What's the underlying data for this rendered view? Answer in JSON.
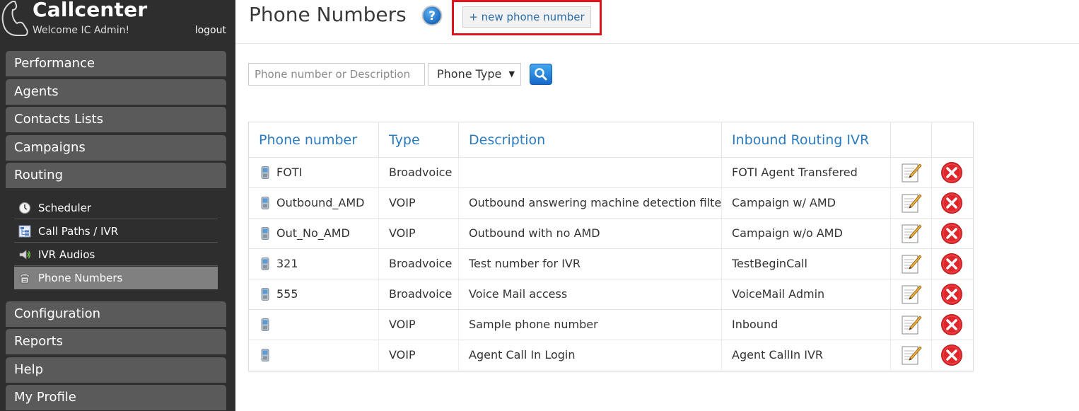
{
  "sidebar": {
    "brand_title": "Callcenter",
    "welcome": "Welcome IC Admin!",
    "logout": "logout",
    "nav_top": [
      {
        "label": "Performance"
      },
      {
        "label": "Agents"
      },
      {
        "label": "Contacts Lists"
      },
      {
        "label": "Campaigns"
      },
      {
        "label": "Routing"
      }
    ],
    "routing_submenu": [
      {
        "label": "Scheduler",
        "icon": "clock-icon"
      },
      {
        "label": "Call Paths / IVR",
        "icon": "call-path-icon"
      },
      {
        "label": "IVR Audios",
        "icon": "speaker-icon"
      },
      {
        "label": "Phone Numbers",
        "icon": "telephone-icon"
      }
    ],
    "nav_bottom": [
      {
        "label": "Configuration"
      },
      {
        "label": "Reports"
      },
      {
        "label": "Help"
      },
      {
        "label": "My Profile"
      }
    ]
  },
  "header": {
    "title": "Phone Numbers",
    "new_button": "+ new phone number"
  },
  "filters": {
    "search_placeholder": "Phone number or Description",
    "type_select": "Phone Type"
  },
  "table": {
    "headers": [
      "Phone number",
      "Type",
      "Description",
      "Inbound Routing IVR"
    ],
    "rows": [
      {
        "number": "FOTI",
        "type": "Broadvoice",
        "description": "",
        "ivr": "FOTI Agent Transfered"
      },
      {
        "number": "Outbound_AMD",
        "type": "VOIP",
        "description": "Outbound answering machine detection filter",
        "ivr": "Campaign w/ AMD"
      },
      {
        "number": "Out_No_AMD",
        "type": "VOIP",
        "description": "Outbound with no AMD",
        "ivr": "Campaign w/o AMD"
      },
      {
        "number": "321",
        "type": "Broadvoice",
        "description": "Test number for IVR",
        "ivr": "TestBeginCall"
      },
      {
        "number": "555",
        "type": "Broadvoice",
        "description": "Voice Mail access",
        "ivr": "VoiceMail Admin"
      },
      {
        "number": "",
        "type": "VOIP",
        "description": "Sample phone number",
        "ivr": "Inbound"
      },
      {
        "number": "",
        "type": "VOIP",
        "description": "Agent Call In Login",
        "ivr": "Agent CallIn IVR"
      }
    ]
  },
  "colors": {
    "sidebar_bg": "#2e2e2e",
    "nav_button": "#5a5a5a",
    "active_subitem": "#808080",
    "link_blue": "#2a7bc0",
    "highlight_red": "#e0141f"
  }
}
